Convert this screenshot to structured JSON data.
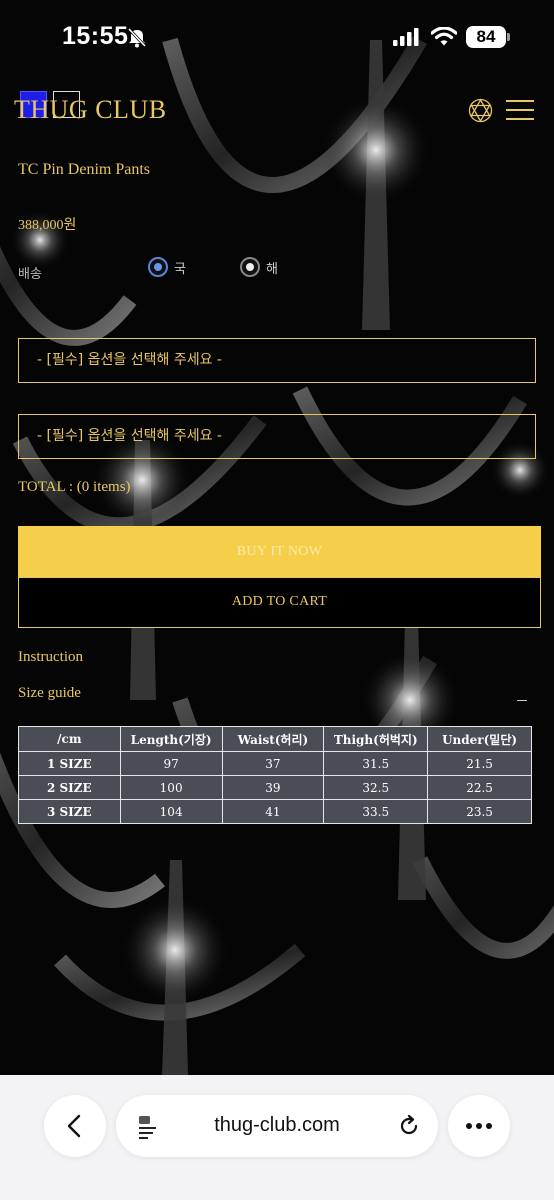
{
  "status_bar": {
    "time": "15:55",
    "battery": "84",
    "icons": [
      "bell-slash-icon",
      "cellular-signal-icon",
      "wifi-icon",
      "battery-icon"
    ]
  },
  "header": {
    "logo": "THUG CLUB",
    "icons": [
      "globe-icon",
      "hamburger-menu-icon"
    ]
  },
  "product": {
    "name": "TC Pin Denim Pants",
    "price": "388,000원",
    "shipping_label": "배송",
    "shipping_options": [
      {
        "label": "국",
        "selected": true
      },
      {
        "label": "해",
        "selected": false
      }
    ]
  },
  "options": {
    "select1_value": "- [필수] 옵션을 선택해 주세요 -",
    "select2_value": "- [필수] 옵션을 선택해 주세요 -"
  },
  "total": "TOTAL : (0 items)",
  "buttons": {
    "buy_now": "BUY IT NOW",
    "add_to_cart": "ADD TO CART"
  },
  "links": {
    "instruction": "Instruction",
    "size_guide": "Size guide"
  },
  "size_table": {
    "headers": [
      "/cm",
      "Length(기장)",
      "Waist(허리)",
      "Thigh(허벅지)",
      "Under(밑단)"
    ],
    "rows": [
      [
        "1 SIZE",
        "97",
        "37",
        "31.5",
        "21.5"
      ],
      [
        "2 SIZE",
        "100",
        "39",
        "32.5",
        "22.5"
      ],
      [
        "3 SIZE",
        "104",
        "41",
        "33.5",
        "23.5"
      ]
    ]
  },
  "browser": {
    "domain": "thug-club.com",
    "icons": [
      "back-chevron-icon",
      "tab-icon",
      "reload-icon",
      "more-icon"
    ]
  },
  "colors": {
    "gold": "#e8c766",
    "buy_button": "#f5cf4a",
    "table_bg": "#4a4d55",
    "radio_selected": "#6b95e8"
  }
}
